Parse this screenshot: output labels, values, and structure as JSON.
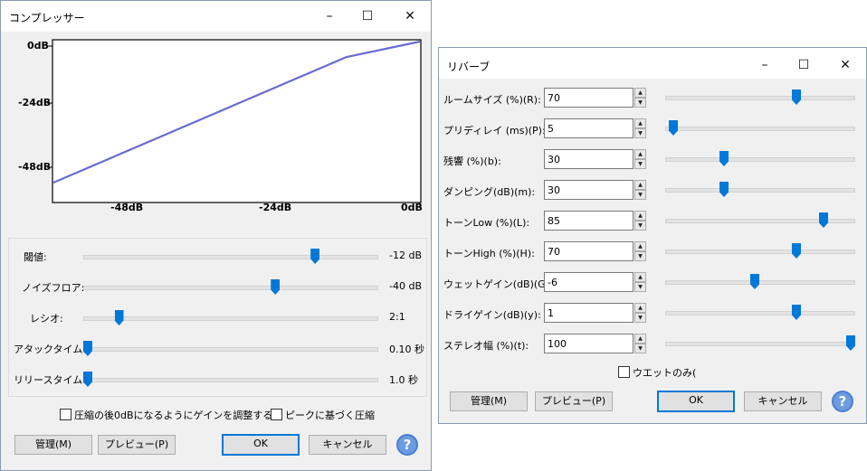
{
  "compressor": {
    "title": "コンプレッサー",
    "controls": {
      "minimize": "–",
      "maximize": "☐",
      "close": "✕"
    },
    "graph": {
      "y_ticks": [
        "0dB",
        "-24dB",
        "-48dB"
      ],
      "x_ticks": [
        "-48dB",
        "-24dB",
        "0dB"
      ],
      "line_color": "#6a6ad2"
    },
    "sliders": [
      {
        "label": "閾値:",
        "value": "-12 dB",
        "level": 0.8
      },
      {
        "label": "ノイズフロア:",
        "value": "-40 dB",
        "level": 0.66
      },
      {
        "label": "レシオ:",
        "value": "2:1",
        "level": 0.11
      },
      {
        "label": "アタックタイム:",
        "value": "0.10 秒",
        "level": 0.0
      },
      {
        "label": "リリースタイム:",
        "value": "1.0 秒",
        "level": 0.0
      }
    ],
    "checkbox_makeup": "圧縮の後0dBになるようにゲインを調整する",
    "checkbox_peak": "ピークに基づく圧縮",
    "buttons": {
      "manage": "管理(M)",
      "preview": "プレビュー(P)",
      "ok": "OK",
      "cancel": "キャンセル",
      "help": "?"
    }
  },
  "reverb": {
    "title": "リバーブ",
    "controls": {
      "minimize": "–",
      "maximize": "☐",
      "close": "✕"
    },
    "params": [
      {
        "label": "ルームサイズ (%)(R):",
        "value": "70",
        "level": 0.7
      },
      {
        "label": "プリディレイ (ms)(P):",
        "value": "5",
        "level": 0.02
      },
      {
        "label": "残響 (%)(b):",
        "value": "30",
        "level": 0.3
      },
      {
        "label": "ダンピング(dB)(m):",
        "value": "30",
        "level": 0.3
      },
      {
        "label": "トーンLow (%)(L):",
        "value": "85",
        "level": 0.85
      },
      {
        "label": "トーンHigh (%)(H):",
        "value": "70",
        "level": 0.7
      },
      {
        "label": "ウェットゲイン(dB)(G):",
        "value": "-6",
        "level": 0.47
      },
      {
        "label": "ドライゲイン(dB)(y):",
        "value": "1",
        "level": 0.7
      },
      {
        "label": "ステレオ幅 (%)(t):",
        "value": "100",
        "level": 1.0
      }
    ],
    "checkbox_wet_only": "ウエットのみ(",
    "buttons": {
      "manage": "管理(M)",
      "preview": "プレビュー(P)",
      "ok": "OK",
      "cancel": "キャンセル",
      "help": "?"
    }
  }
}
